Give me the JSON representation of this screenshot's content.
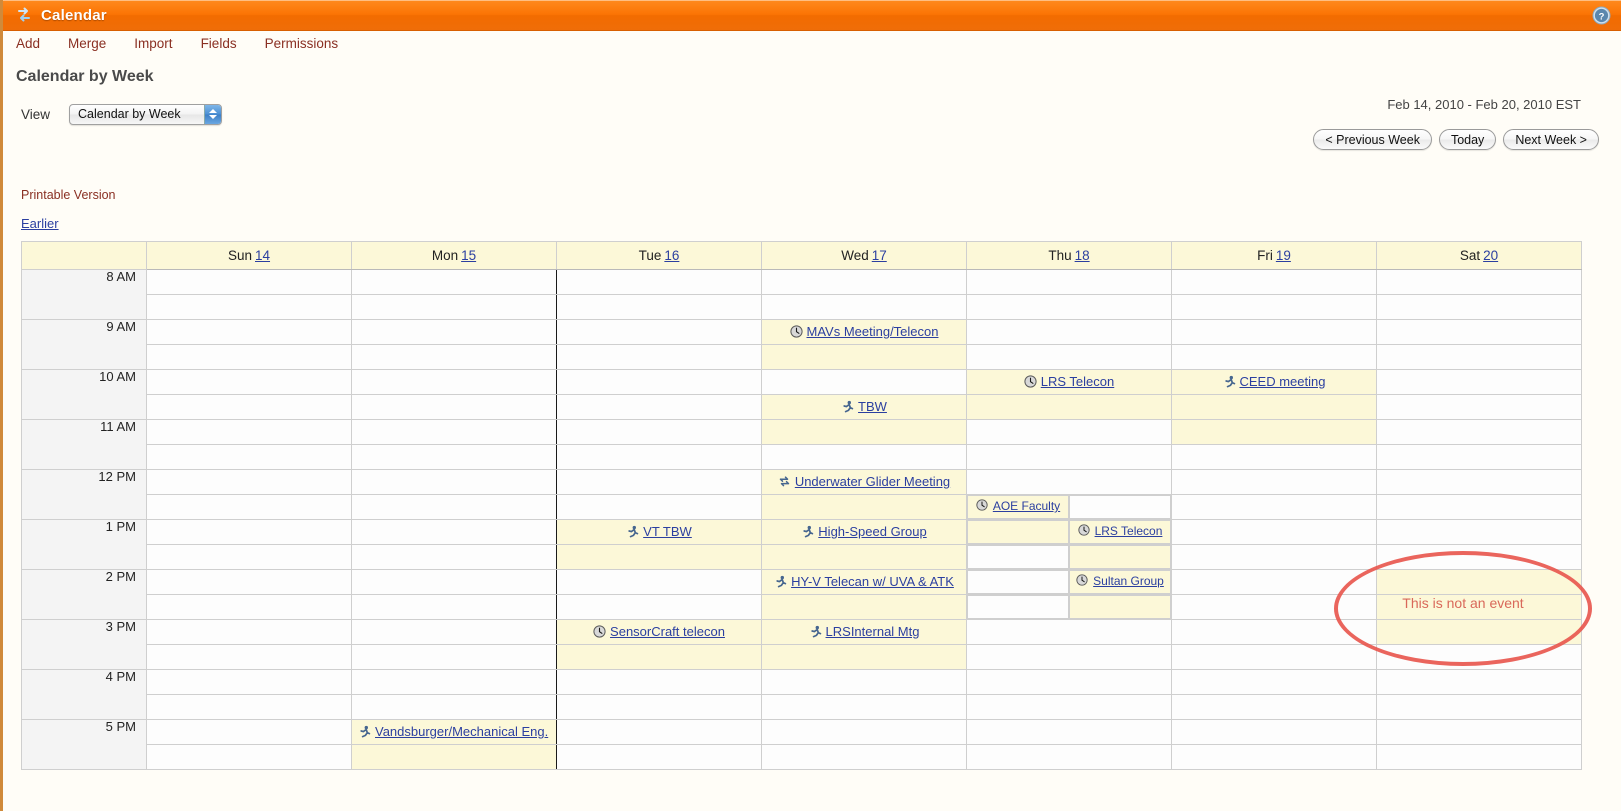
{
  "window": {
    "title": "Calendar",
    "title_icon": "sync-arrows-icon",
    "help_icon": "help-question-icon"
  },
  "menu": {
    "items": [
      {
        "label": "Add",
        "name": "menu-add"
      },
      {
        "label": "Merge",
        "name": "menu-merge"
      },
      {
        "label": "Import",
        "name": "menu-import"
      },
      {
        "label": "Fields",
        "name": "menu-fields"
      },
      {
        "label": "Permissions",
        "name": "menu-permissions"
      }
    ]
  },
  "page": {
    "heading": "Calendar by Week",
    "view_label": "View",
    "view_selected": "Calendar by Week",
    "date_range": "Feb 14, 2010 - Feb 20, 2010 EST",
    "printable_link": "Printable Version",
    "earlier_link": "Earlier"
  },
  "nav": {
    "previous": "< Previous Week",
    "today": "Today",
    "next": "Next Week >"
  },
  "calendar": {
    "days": [
      {
        "name": "Sun",
        "num": "14",
        "today": false
      },
      {
        "name": "Mon",
        "num": "15",
        "today": true
      },
      {
        "name": "Tue",
        "num": "16",
        "today": false
      },
      {
        "name": "Wed",
        "num": "17",
        "today": false
      },
      {
        "name": "Thu",
        "num": "18",
        "today": false
      },
      {
        "name": "Fri",
        "num": "19",
        "today": false
      },
      {
        "name": "Sat",
        "num": "20",
        "today": false
      }
    ],
    "times": [
      "8 AM",
      "9 AM",
      "10 AM",
      "11 AM",
      "12 PM",
      "1 PM",
      "2 PM",
      "3 PM",
      "4 PM",
      "5 PM"
    ],
    "events": [
      {
        "day": "Wed",
        "day_index": 3,
        "time": "9 AM",
        "title": "MAVs Meeting/Telecon",
        "icon": "clock-icon"
      },
      {
        "day": "Wed",
        "day_index": 3,
        "time": "10:30 AM",
        "title": "TBW",
        "icon": "person-running-icon"
      },
      {
        "day": "Wed",
        "day_index": 3,
        "time": "12 PM",
        "title": "Underwater Glider Meeting",
        "icon": "swap-arrows-icon"
      },
      {
        "day": "Wed",
        "day_index": 3,
        "time": "1 PM",
        "title": "High-Speed Group",
        "icon": "person-running-icon"
      },
      {
        "day": "Wed",
        "day_index": 3,
        "time": "2 PM",
        "title": "HY-V Telecan w/ UVA & ATK",
        "icon": "person-running-icon"
      },
      {
        "day": "Wed",
        "day_index": 3,
        "time": "3 PM",
        "title": "LRSInternal Mtg",
        "icon": "person-running-icon"
      },
      {
        "day": "Thu",
        "day_index": 4,
        "time": "10 AM",
        "title": "LRS Telecon",
        "icon": "clock-icon"
      },
      {
        "day": "Thu",
        "day_index": 4,
        "time": "12:30 PM",
        "title": "AOE Faculty Meeting",
        "icon": "clock-icon"
      },
      {
        "day": "Thu",
        "day_index": 4,
        "time": "1 PM",
        "title": "LRS Telecon",
        "icon": "clock-icon"
      },
      {
        "day": "Thu",
        "day_index": 4,
        "time": "2 PM",
        "title": "Sultan Group",
        "icon": "clock-icon"
      },
      {
        "day": "Fri",
        "day_index": 5,
        "time": "10 AM",
        "title": "CEED meeting",
        "icon": "person-running-icon"
      },
      {
        "day": "Tue",
        "day_index": 2,
        "time": "1 PM",
        "title": "VT TBW",
        "icon": "person-running-icon"
      },
      {
        "day": "Tue",
        "day_index": 2,
        "time": "3 PM",
        "title": "SensorCraft telecon",
        "icon": "clock-icon"
      },
      {
        "day": "Mon",
        "day_index": 1,
        "time": "5 PM",
        "title": "Vandsburger/Mechanical Eng.",
        "icon": "person-running-icon"
      }
    ],
    "labels": {
      "mavs": "MAVs Meeting/Telecon",
      "tbw": "TBW",
      "underwater": "Underwater Glider Meeting",
      "highspeed": "High-Speed Group",
      "hyv": "HY-V Telecan w/ UVA & ATK",
      "lrsinternal": "LRSInternal Mtg",
      "lrstelecon": "LRS Telecon",
      "aoefaculty": "AOE Faculty",
      "lrstelecon2": "LRS Telecon",
      "sultan": "Sultan Group",
      "ceed": "CEED meeting",
      "vttbw": "VT TBW",
      "sensorcraft": "SensorCraft telecon",
      "vandsburger": "Vandsburger/Mechanical Eng."
    }
  },
  "annotation": {
    "text": "This is not an event",
    "shape": "red-ellipse",
    "color": "#e8584f"
  },
  "colors": {
    "titlebar_orange": "#f97b0a",
    "event_yellow": "#fcf8d8",
    "link_blue": "#2b3fa0",
    "menu_red": "#8a2f22",
    "annotation_red": "#e8584f"
  }
}
